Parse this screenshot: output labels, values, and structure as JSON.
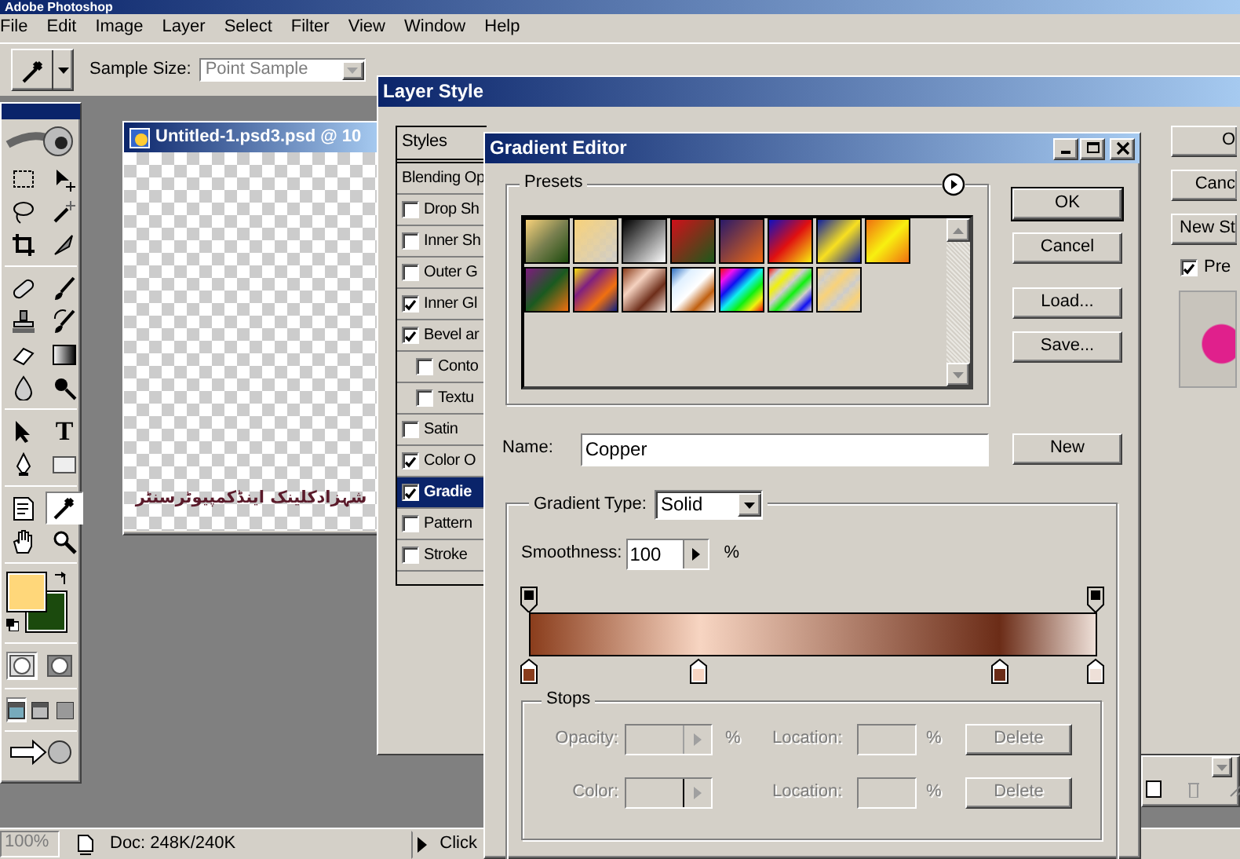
{
  "app": {
    "title": "Adobe Photoshop",
    "menu": [
      "File",
      "Edit",
      "Image",
      "Layer",
      "Select",
      "Filter",
      "View",
      "Window",
      "Help"
    ]
  },
  "options_bar": {
    "sample_size_label": "Sample Size:",
    "sample_size": "Point Sample",
    "disabled": true
  },
  "toolbox": {
    "tools": [
      {
        "kind": "marquee",
        "selected": false
      },
      {
        "kind": "move",
        "selected": false
      },
      {
        "kind": "lasso",
        "selected": false
      },
      {
        "kind": "wand",
        "selected": false
      },
      {
        "kind": "crop",
        "selected": false
      },
      {
        "kind": "slice",
        "selected": false
      },
      {
        "kind": "heal",
        "selected": false
      },
      {
        "kind": "brush",
        "selected": false
      },
      {
        "kind": "stamp",
        "selected": false
      },
      {
        "kind": "history",
        "selected": false
      },
      {
        "kind": "eraser",
        "selected": false
      },
      {
        "kind": "gradient",
        "selected": false
      },
      {
        "kind": "blur",
        "selected": false
      },
      {
        "kind": "dodge",
        "selected": false
      },
      {
        "kind": "pointer",
        "selected": false
      },
      {
        "kind": "type",
        "selected": false,
        "glyph": "T"
      },
      {
        "kind": "pen",
        "selected": false
      },
      {
        "kind": "shape",
        "selected": false
      },
      {
        "kind": "note",
        "selected": false
      },
      {
        "kind": "eyedropper",
        "selected": true
      },
      {
        "kind": "hand",
        "selected": false
      },
      {
        "kind": "zoom",
        "selected": false
      }
    ],
    "swatches": [
      {
        "kind": "foreground",
        "color": "#ffd77a"
      },
      {
        "kind": "background",
        "color": "#1b4a0d"
      }
    ],
    "mask_modes": [
      {
        "selected": true
      },
      {
        "selected": false
      }
    ],
    "screen_modes": [
      {
        "selected": true
      },
      {
        "selected": false
      },
      {
        "selected": false
      }
    ]
  },
  "document": {
    "title": "Untitled-1.psd3.psd @ 10",
    "text": "شہزادکلینک اینڈکمپیوٹرسنٹر"
  },
  "status_bar": {
    "zoom": "100%",
    "info": "Doc: 248K/240K",
    "hint": "Click"
  },
  "layer_style": {
    "title": "Layer Style",
    "header": "Styles",
    "items": [
      {
        "kind": "plain",
        "label": "Blending Op",
        "selected": false
      },
      {
        "kind": "check",
        "label": "Drop Sh",
        "checked": false,
        "selected": false
      },
      {
        "kind": "check",
        "label": "Inner Sh",
        "checked": false,
        "selected": false
      },
      {
        "kind": "check",
        "label": "Outer G",
        "checked": false,
        "selected": false
      },
      {
        "kind": "check",
        "label": "Inner Gl",
        "checked": true,
        "selected": false
      },
      {
        "kind": "check",
        "label": "Bevel ar",
        "checked": true,
        "selected": false,
        "children": [
          {
            "kind": "check",
            "label": "Conto",
            "checked": false,
            "selected": false
          },
          {
            "kind": "check",
            "label": "Textu",
            "checked": false,
            "selected": false
          }
        ]
      },
      {
        "kind": "check",
        "label": "Satin",
        "checked": false,
        "selected": false
      },
      {
        "kind": "check",
        "label": "Color O",
        "checked": true,
        "selected": false
      },
      {
        "kind": "check",
        "label": "Gradie",
        "checked": true,
        "selected": true
      },
      {
        "kind": "check",
        "label": "Pattern",
        "checked": false,
        "selected": false
      },
      {
        "kind": "check",
        "label": "Stroke",
        "checked": false,
        "selected": false
      }
    ],
    "buttons": [
      "O",
      "Canc",
      "New St"
    ],
    "preview": {
      "label": "Pre",
      "checked": true
    }
  },
  "gradient_editor": {
    "title": "Gradient Editor",
    "presets_label": "Presets",
    "buttons": [
      "OK",
      "Cancel",
      "Load...",
      "Save..."
    ],
    "name_label": "Name:",
    "name": "Copper",
    "new_button": "New",
    "type_label": "Gradient Type:",
    "type": "Solid",
    "smoothness_label": "Smoothness:",
    "smoothness": "100",
    "smoothness_unit": "%",
    "opacity_stops": [
      {
        "level": 0
      },
      {
        "level": 1
      }
    ],
    "color_stops": [
      {
        "level": 0,
        "color": "#8a3d1c"
      },
      {
        "level": 0.3,
        "color": "#f7d5c2"
      },
      {
        "level": 0.83,
        "color": "#6b2c17"
      },
      {
        "level": 1,
        "color": "#eee0d8"
      }
    ],
    "stops": {
      "label": "Stops",
      "rows": [
        {
          "label": "Opacity:",
          "unit": "%",
          "location_label": "Location:",
          "location_unit": "%",
          "delete": "Delete",
          "disabled": true
        },
        {
          "label": "Color:",
          "unit": "",
          "location_label": "Location:",
          "location_unit": "%",
          "delete": "Delete",
          "disabled": true
        }
      ]
    }
  }
}
